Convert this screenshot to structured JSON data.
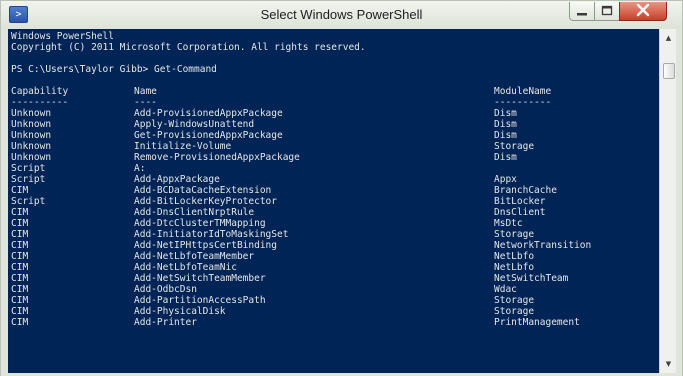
{
  "window": {
    "title": "Select Windows PowerShell",
    "icon": "powershell-icon"
  },
  "controls": {
    "minimize_icon": "minimize-icon",
    "maximize_icon": "maximize-icon",
    "close_icon": "close-icon"
  },
  "console": {
    "lines": [
      "Windows PowerShell",
      "Copyright (C) 2011 Microsoft Corporation. All rights reserved.",
      "",
      "PS C:\\Users\\Taylor Gibb> Get-Command"
    ],
    "headers": {
      "capability": "Capability",
      "name": "Name",
      "module": "ModuleName"
    },
    "separators": {
      "capability": "----------",
      "name": "----",
      "module": "----------"
    },
    "rows": [
      {
        "capability": "Unknown",
        "name": "Add-ProvisionedAppxPackage",
        "module": "Dism"
      },
      {
        "capability": "Unknown",
        "name": "Apply-WindowsUnattend",
        "module": "Dism"
      },
      {
        "capability": "Unknown",
        "name": "Get-ProvisionedAppxPackage",
        "module": "Dism"
      },
      {
        "capability": "Unknown",
        "name": "Initialize-Volume",
        "module": "Storage"
      },
      {
        "capability": "Unknown",
        "name": "Remove-ProvisionedAppxPackage",
        "module": "Dism"
      },
      {
        "capability": "Script",
        "name": "A:",
        "module": ""
      },
      {
        "capability": "Script",
        "name": "Add-AppxPackage",
        "module": "Appx"
      },
      {
        "capability": "CIM",
        "name": "Add-BCDataCacheExtension",
        "module": "BranchCache"
      },
      {
        "capability": "Script",
        "name": "Add-BitLockerKeyProtector",
        "module": "BitLocker"
      },
      {
        "capability": "CIM",
        "name": "Add-DnsClientNrptRule",
        "module": "DnsClient"
      },
      {
        "capability": "CIM",
        "name": "Add-DtcClusterTMMapping",
        "module": "MsDtc"
      },
      {
        "capability": "CIM",
        "name": "Add-InitiatorIdToMaskingSet",
        "module": "Storage"
      },
      {
        "capability": "CIM",
        "name": "Add-NetIPHttpsCertBinding",
        "module": "NetworkTransition"
      },
      {
        "capability": "CIM",
        "name": "Add-NetLbfoTeamMember",
        "module": "NetLbfo"
      },
      {
        "capability": "CIM",
        "name": "Add-NetLbfoTeamNic",
        "module": "NetLbfo"
      },
      {
        "capability": "CIM",
        "name": "Add-NetSwitchTeamMember",
        "module": "NetSwitchTeam"
      },
      {
        "capability": "CIM",
        "name": "Add-OdbcDsn",
        "module": "Wdac"
      },
      {
        "capability": "CIM",
        "name": "Add-PartitionAccessPath",
        "module": "Storage"
      },
      {
        "capability": "CIM",
        "name": "Add-PhysicalDisk",
        "module": "Storage"
      },
      {
        "capability": "CIM",
        "name": "Add-Printer",
        "module": "PrintManagement"
      }
    ]
  },
  "scrollbar": {
    "up_icon": "scroll-up-icon",
    "down_icon": "scroll-down-icon"
  },
  "colors": {
    "console_background": "#012456",
    "console_text": "#e6e6e6",
    "close_button": "#c7402b"
  }
}
